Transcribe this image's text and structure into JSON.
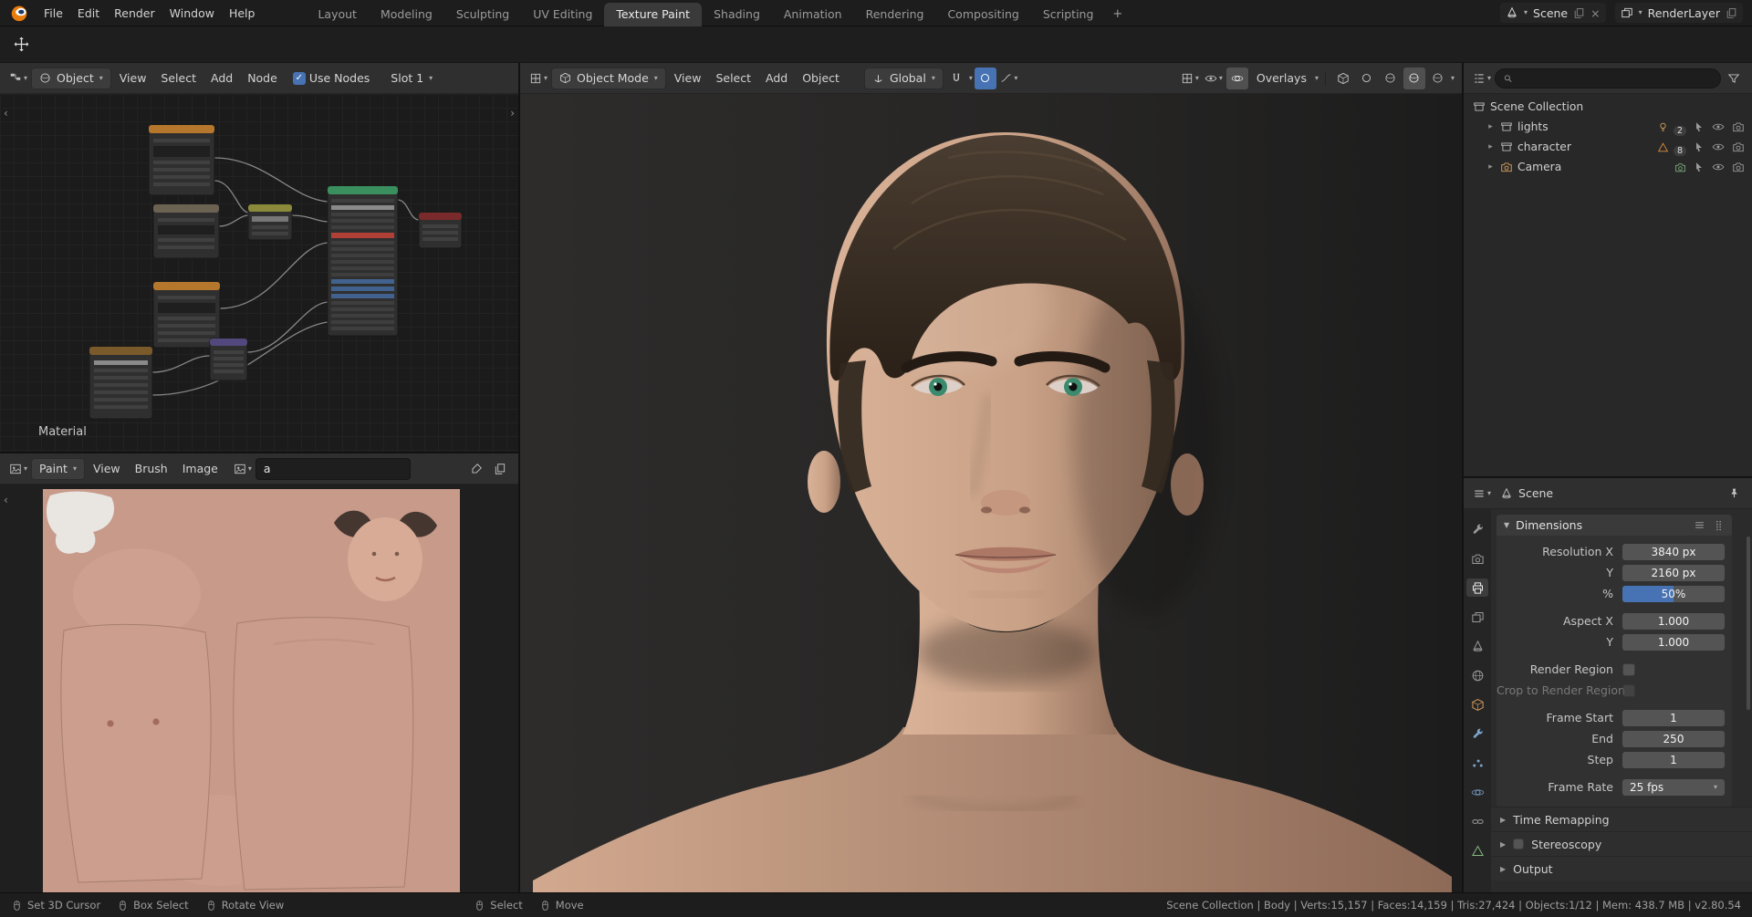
{
  "colors": {
    "accent": "#4772b3",
    "skin": "#cfa48c",
    "header_bg": "#2f2f2f"
  },
  "icons": {
    "blender-logo": "orange circle with white ring",
    "search-icon": "magnifier",
    "filter-icon": "funnel",
    "magnet-icon": "snap magnet",
    "eye-icon": "visibility eye",
    "camera-icon": "render camera",
    "pointer-icon": "selection cursor",
    "move-tool-icon": "cross arrows",
    "pin-icon": "pushpin",
    "mouse-icon": "mouse button hint"
  },
  "topbar": {
    "menus": [
      "File",
      "Edit",
      "Render",
      "Window",
      "Help"
    ],
    "tabs": [
      "Layout",
      "Modeling",
      "Sculpting",
      "UV Editing",
      "Texture Paint",
      "Shading",
      "Animation",
      "Rendering",
      "Compositing",
      "Scripting"
    ],
    "new_tab": "+",
    "scene": {
      "label": "Scene"
    },
    "view_layer": {
      "label": "RenderLayer"
    }
  },
  "node_editor": {
    "type_label": "Object",
    "menus": [
      "View",
      "Select",
      "Add",
      "Node"
    ],
    "use_nodes_label": "Use Nodes",
    "slot_label": "Slot 1",
    "material_name": "Material"
  },
  "image_editor": {
    "mode_label": "Paint",
    "menus": [
      "View",
      "Brush",
      "Image"
    ],
    "image_name": "a"
  },
  "viewport": {
    "mode_label": "Object Mode",
    "menus": [
      "View",
      "Select",
      "Add",
      "Object"
    ],
    "orientation_label": "Global",
    "overlays_label": "Overlays"
  },
  "outliner": {
    "root_label": "Scene Collection",
    "items": [
      {
        "label": "lights",
        "count": "2"
      },
      {
        "label": "character",
        "count": "8"
      },
      {
        "label": "Camera",
        "count": ""
      }
    ]
  },
  "properties": {
    "breadcrumb": "Scene",
    "dimensions_title": "Dimensions",
    "rows": [
      {
        "label": "Resolution X",
        "value": "3840 px"
      },
      {
        "label": "Y",
        "value": "2160 px"
      },
      {
        "label": "%",
        "value": "50%"
      },
      {
        "label": "Aspect X",
        "value": "1.000"
      },
      {
        "label": "Y",
        "value": "1.000"
      },
      {
        "label": "Render Region",
        "value": ""
      },
      {
        "label": "Crop to Render Region",
        "value": ""
      },
      {
        "label": "Frame Start",
        "value": "1"
      },
      {
        "label": "End",
        "value": "250"
      },
      {
        "label": "Step",
        "value": "1"
      },
      {
        "label": "Frame Rate",
        "value": "25 fps"
      }
    ],
    "collapsed_panels": [
      "Time Remapping",
      "Stereoscopy",
      "Output"
    ]
  },
  "statusbar": {
    "hints_left": [
      "Set 3D Cursor",
      "Box Select",
      "Rotate View"
    ],
    "hints_tool": [
      "Select",
      "Move"
    ],
    "info": "Scene Collection | Body | Verts:15,157 | Faces:14,159 | Tris:27,424 | Objects:1/12 | Mem: 438.7 MB | v2.80.54"
  }
}
